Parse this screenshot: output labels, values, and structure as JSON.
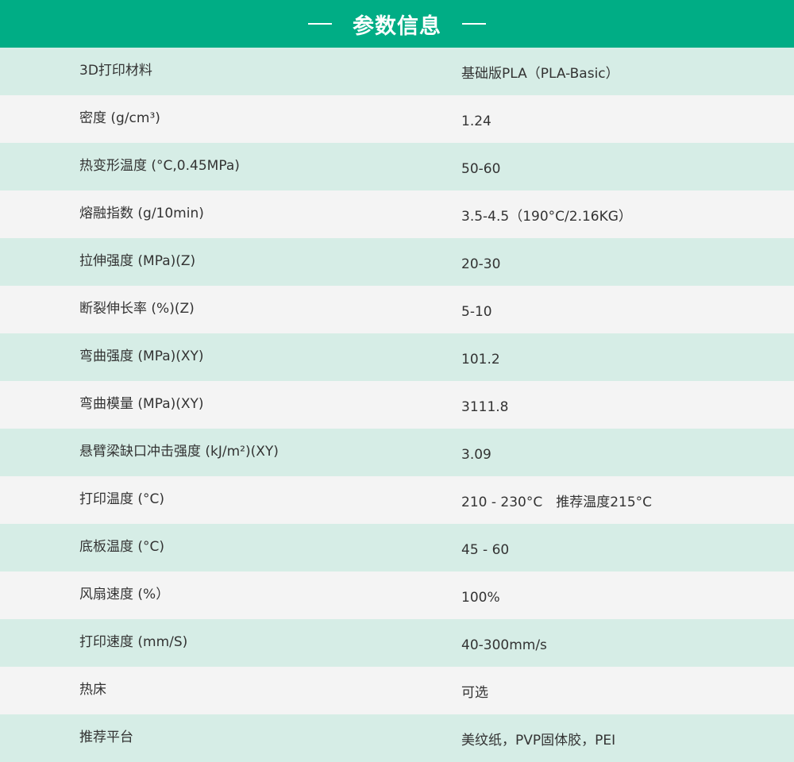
{
  "header": {
    "title": "参数信息",
    "background_color": "#00ad85",
    "text_color": "#ffffff"
  },
  "row_colors": {
    "green": "#d6ede6",
    "grey": "#f4f4f4"
  },
  "rows": [
    {
      "label": "3D打印材料",
      "value": "基础版PLA（PLA-Basic）"
    },
    {
      "label": "密度 (g/cm³)",
      "value": "1.24"
    },
    {
      "label": "热变形温度 (°C,0.45MPa)",
      "value": "50-60"
    },
    {
      "label": "熔融指数 (g/10min)",
      "value": "3.5-4.5（190°C/2.16KG）"
    },
    {
      "label": "拉伸强度 (MPa)(Z)",
      "value": "20-30"
    },
    {
      "label": "断裂伸长率 (%)(Z)",
      "value": "5-10"
    },
    {
      "label": "弯曲强度 (MPa)(XY)",
      "value": "101.2"
    },
    {
      "label": "弯曲模量 (MPa)(XY)",
      "value": "3111.8"
    },
    {
      "label": "悬臂梁缺口冲击强度 (kJ/m²)(XY)",
      "value": "3.09"
    },
    {
      "label": "打印温度 (°C)",
      "value": "210 - 230°C　推荐温度215°C"
    },
    {
      "label": "底板温度 (°C)",
      "value": "45 - 60"
    },
    {
      "label": "风扇速度 (%）",
      "value": "100%"
    },
    {
      "label": "打印速度 (mm/S)",
      "value": "40-300mm/s"
    },
    {
      "label": "热床",
      "value": "可选"
    },
    {
      "label": "推荐平台",
      "value": "美纹纸，PVP固体胶，PEI"
    }
  ]
}
